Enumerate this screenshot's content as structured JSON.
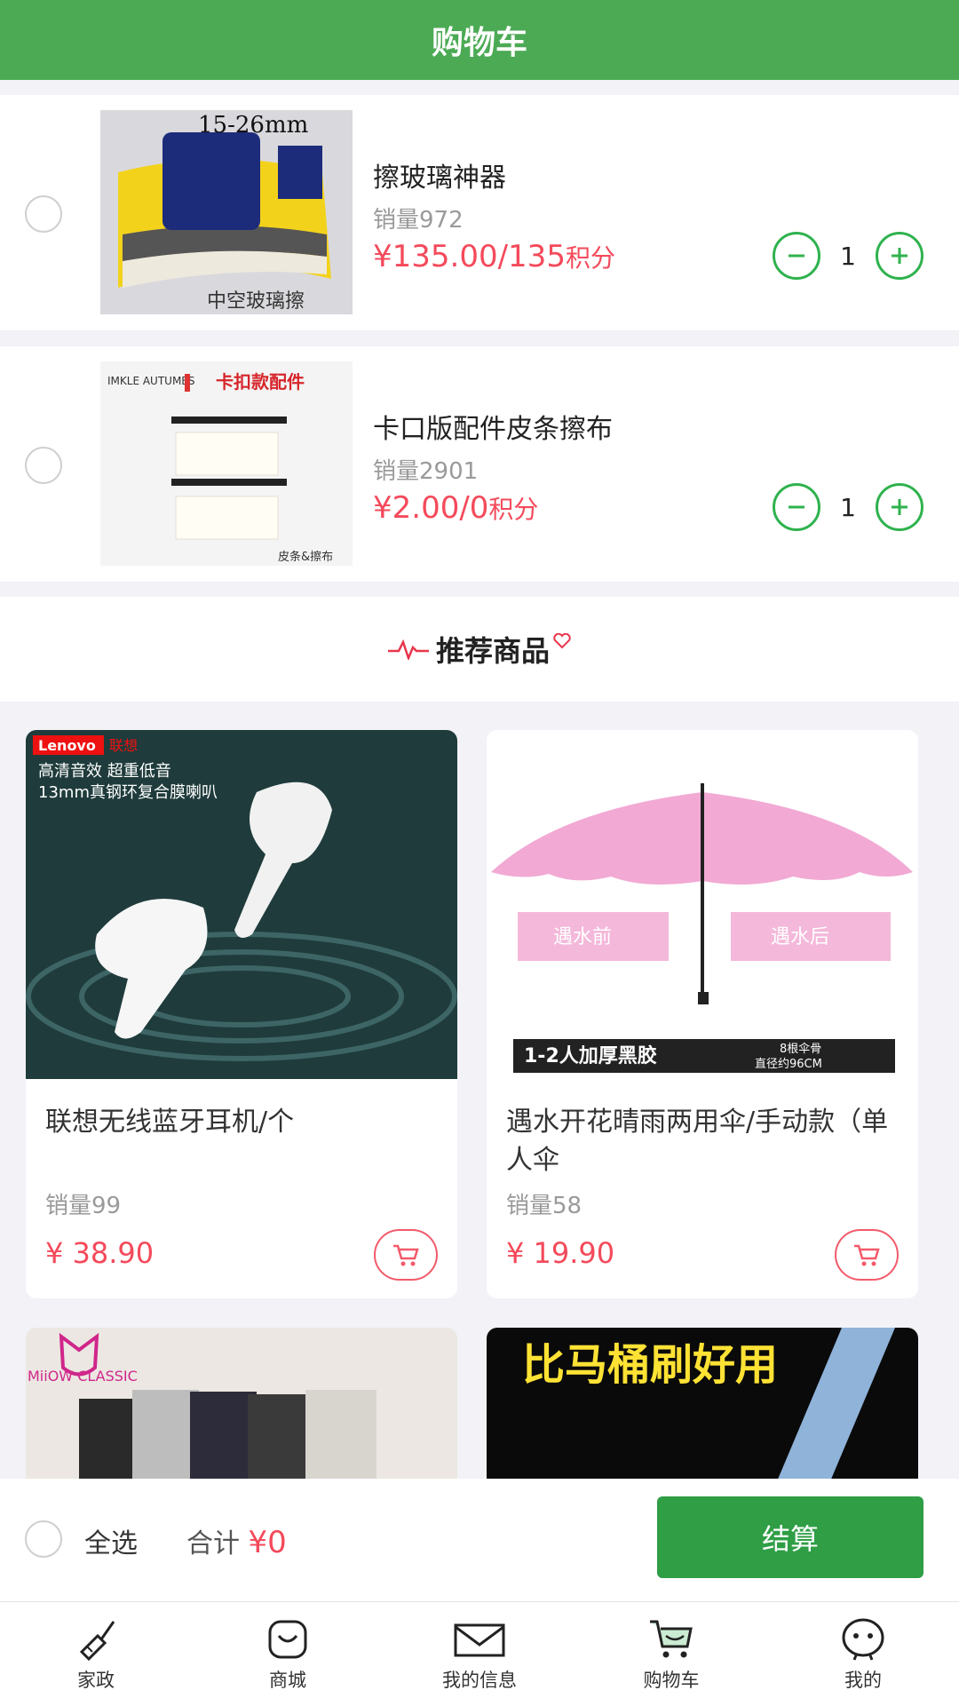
{
  "header": {
    "title": "购物车"
  },
  "cart_items": [
    {
      "name": "擦玻璃神器",
      "sales": "销量972",
      "price": "¥135.00/135",
      "points_label": "积分",
      "quantity": "1",
      "image_text_top": "15-26mm",
      "image_text_bottom": "中空玻璃擦"
    },
    {
      "name": "卡口版配件皮条擦布",
      "sales": "销量2901",
      "price": "¥2.00/0",
      "points_label": "积分",
      "quantity": "1",
      "image_text_top": "卡扣款配件",
      "image_text_bottom": "皮条&擦布",
      "image_brand": "IMKLE AUTUMES"
    }
  ],
  "recommend": {
    "title": "推荐商品"
  },
  "products": [
    {
      "title": "联想无线蓝牙耳机/个",
      "sales": "销量99",
      "price": "¥ 38.90",
      "image_brand": "Lenovo",
      "image_brand_cn": "联想",
      "image_line1": "高清音效 超重低音",
      "image_line2": "13mm真钢环复合膜喇叭"
    },
    {
      "title": "遇水开花晴雨两用伞/手动款（单人伞",
      "sales": "销量58",
      "price": "¥ 19.90",
      "image_before": "遇水前",
      "image_after": "遇水后",
      "image_band_left": "1-2人加厚黑胶",
      "image_band_right_1": "8根伞骨",
      "image_band_right_2": "直径约96CM"
    },
    {
      "image_brand": "MiiOW CLASSIC"
    },
    {
      "image_headline": "比马桶刷好用"
    }
  ],
  "bottom_bar": {
    "select_all": "全选",
    "total_label": "合计",
    "total_amount": "¥0",
    "checkout": "结算"
  },
  "tabs": [
    {
      "label": "家政",
      "icon": "broom-icon"
    },
    {
      "label": "商城",
      "icon": "smile-bag-icon"
    },
    {
      "label": "我的信息",
      "icon": "envelope-icon"
    },
    {
      "label": "购物车",
      "icon": "cart-icon"
    },
    {
      "label": "我的",
      "icon": "face-icon"
    }
  ],
  "colors": {
    "header": "#4caa55",
    "accent_green": "#2f9e45",
    "price_red": "#f44a5b"
  }
}
